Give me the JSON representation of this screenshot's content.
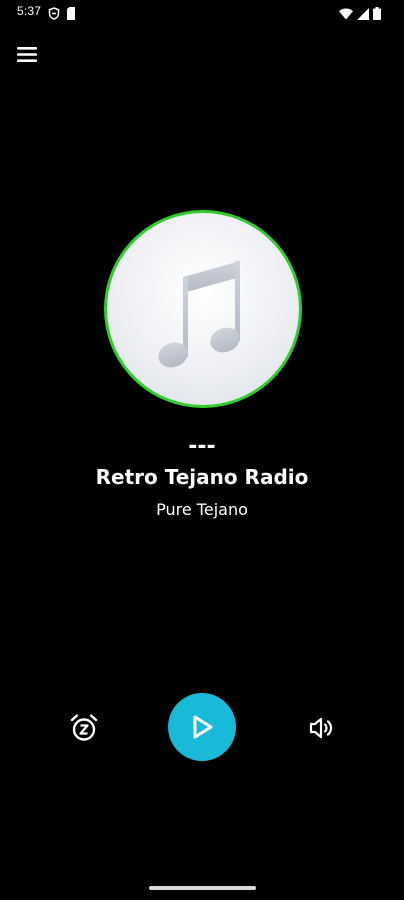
{
  "status_bar": {
    "time": "5:37",
    "left_icons": [
      "shield-icon",
      "sim-card-icon"
    ],
    "right_icons": [
      "wifi-icon",
      "cell-signal-icon",
      "battery-icon"
    ]
  },
  "toolbar": {
    "menu_icon": "hamburger-menu-icon"
  },
  "now_playing": {
    "artwork_icon": "music-note-icon",
    "artwork_ring_color": "#33cc2e",
    "track_title": "---",
    "station_name": "Retro Tejano Radio",
    "station_tagline": "Pure Tejano"
  },
  "controls": {
    "alarm_icon": "alarm-clock-z-icon",
    "play_icon": "play-icon",
    "play_button_color": "#19b9d8",
    "volume_icon": "volume-icon"
  }
}
